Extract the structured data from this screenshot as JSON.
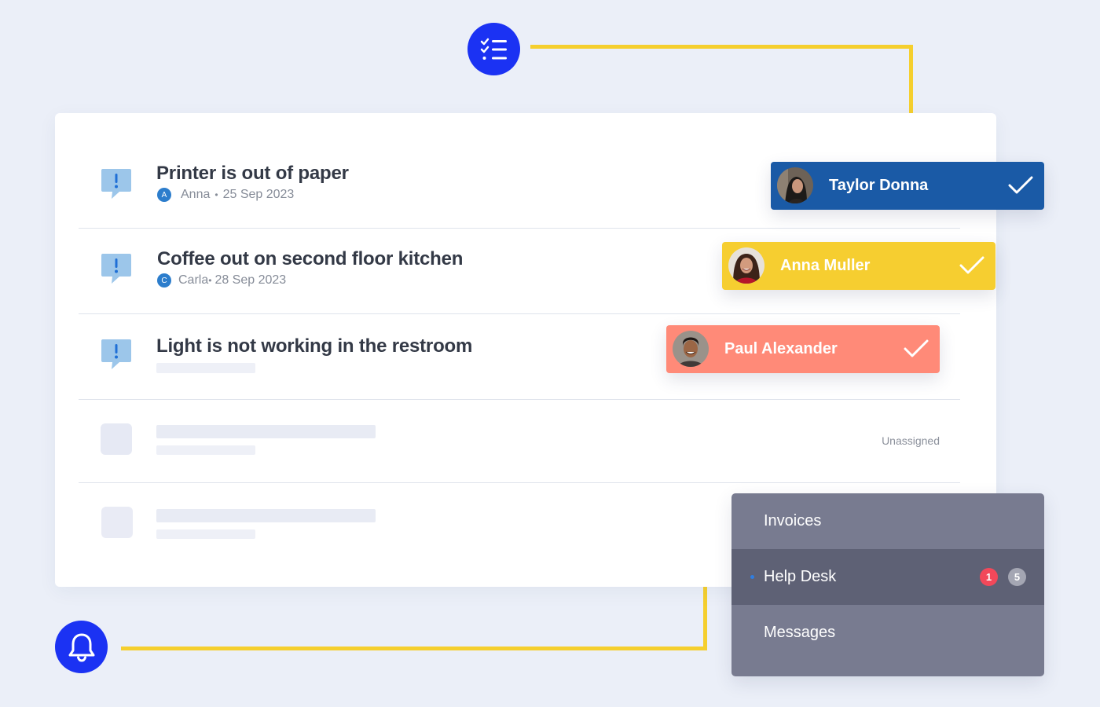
{
  "tickets": [
    {
      "title": "Printer is out of paper",
      "author_initial": "A",
      "author": "Anna",
      "separator": "•",
      "date": "25 Sep 2023"
    },
    {
      "title": "Coffee out on second floor kitchen",
      "author_initial": "C",
      "author": "Carla",
      "separator": "•",
      "date": "28 Sep 2023"
    },
    {
      "title": "Light is not working in the restroom"
    }
  ],
  "placeholder_row": {
    "status": "Unassigned"
  },
  "assignees": [
    {
      "name": "Taylor Donna",
      "color": "#1a5aa6",
      "icon": "check-icon"
    },
    {
      "name": "Anna Muller",
      "color": "#f6ce30",
      "icon": "check-icon"
    },
    {
      "name": "Paul Alexander",
      "color": "#ff8a78",
      "icon": "check-icon"
    }
  ],
  "nav_menu": {
    "items": [
      {
        "label": "Invoices"
      },
      {
        "label": "Help Desk",
        "badges": [
          "1",
          "5"
        ]
      },
      {
        "label": "Messages"
      }
    ]
  },
  "icons": {
    "top": "checklist-icon",
    "bottom": "bell-icon",
    "ticket": "alert-message-icon"
  },
  "colors": {
    "accent_blue": "#1b32f3",
    "connector": "#f5cf2e",
    "badge_red": "#f2485a",
    "badge_gray": "#a4a6b3"
  }
}
